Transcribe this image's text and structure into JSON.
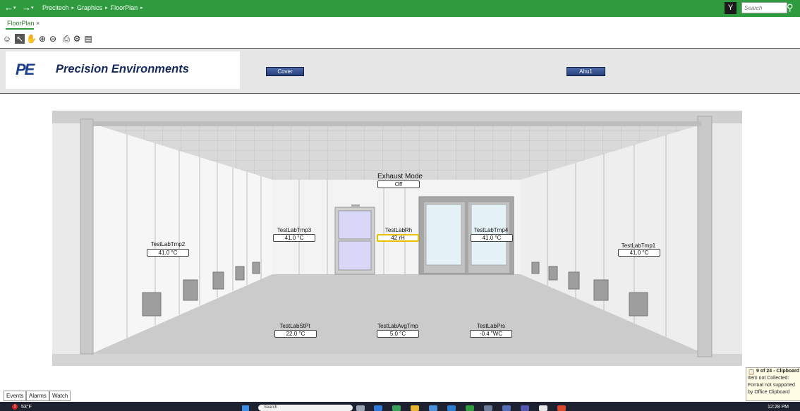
{
  "nav": {
    "back": "←",
    "forward": "→",
    "breadcrumb": [
      "Precitech",
      "Graphics",
      "FloorPlan"
    ],
    "separator": "▸"
  },
  "search": {
    "placeholder": "Search"
  },
  "tabs": {
    "active": "FloorPlan",
    "close": "×"
  },
  "logo": {
    "mark": "PE",
    "text": "Precision Environments"
  },
  "buttons": {
    "cover": "Cover",
    "ahu1": "Ahu1"
  },
  "room": {
    "exhaust": {
      "label": "Exhaust Mode",
      "value": "Off"
    },
    "points": [
      {
        "label": "TestLabTmp2",
        "value": "41.0 °C"
      },
      {
        "label": "TestLabTmp3",
        "value": "41.0 °C"
      },
      {
        "label": "TestLabRh",
        "value": "42 rH"
      },
      {
        "label": "TestLabTmp4",
        "value": "41.0 °C"
      },
      {
        "label": "TestLabTmp1",
        "value": "41.0 °C"
      },
      {
        "label": "TestLabStPt",
        "value": "22.0 °C"
      },
      {
        "label": "TestLabAvgTmp",
        "value": "5.0 °C"
      },
      {
        "label": "TestLabPrs",
        "value": "-0.4 \"WC"
      }
    ]
  },
  "bottom_tabs": [
    "Events",
    "Alarms",
    "Watch"
  ],
  "clipboard": {
    "title": "9 of 24 - Clipboard",
    "message": "Item not Collected: Format not supported by Office Clipboard"
  },
  "taskbar": {
    "weather": "53°F",
    "badge": "1",
    "search_placeholder": "Search",
    "clock": "12:28 PM"
  },
  "colors": {
    "topbar": "#2e9b3e",
    "button": "#243f7c",
    "highlight": "#e6c200"
  }
}
